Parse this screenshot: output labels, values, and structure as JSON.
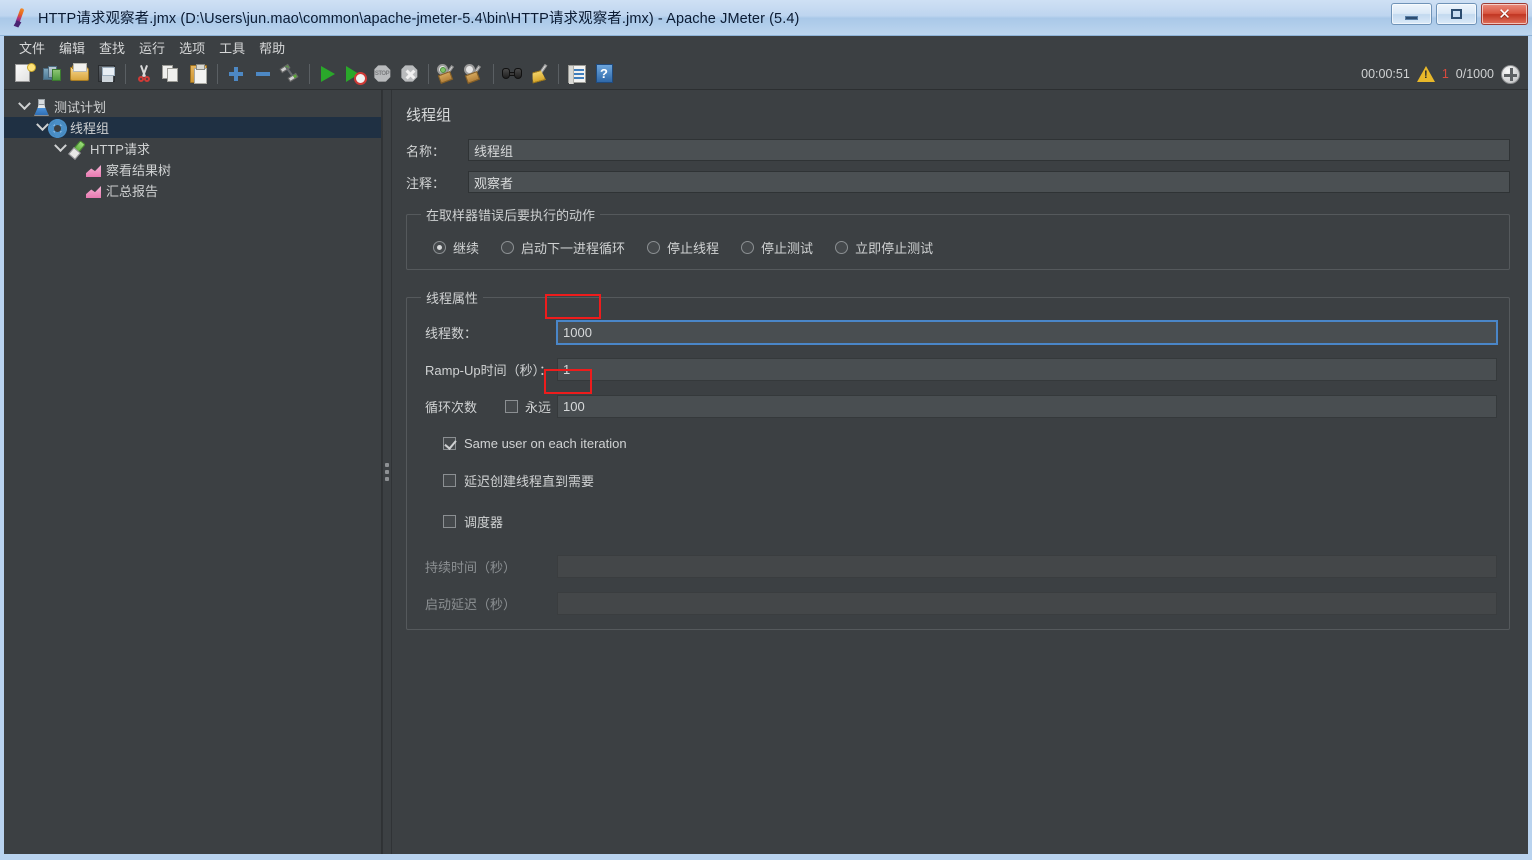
{
  "window": {
    "title": "HTTP请求观察者.jmx (D:\\Users\\jun.mao\\common\\apache-jmeter-5.4\\bin\\HTTP请求观察者.jmx) - Apache JMeter (5.4)",
    "app_icon": "jmeter-feather-icon",
    "buttons": {
      "minimize": "minimize-icon",
      "maximize": "maximize-icon",
      "close": "✕"
    }
  },
  "menubar": {
    "items": [
      {
        "label": "文件",
        "name": "menu-file"
      },
      {
        "label": "编辑",
        "name": "menu-edit"
      },
      {
        "label": "查找",
        "name": "menu-search"
      },
      {
        "label": "运行",
        "name": "menu-run"
      },
      {
        "label": "选项",
        "name": "menu-options"
      },
      {
        "label": "工具",
        "name": "menu-tools"
      },
      {
        "label": "帮助",
        "name": "menu-help"
      }
    ]
  },
  "toolbar": {
    "items": [
      {
        "icon": "new-document-icon"
      },
      {
        "icon": "templates-icon"
      },
      {
        "icon": "open-folder-icon"
      },
      {
        "icon": "save-icon"
      },
      {
        "icon": "cut-icon"
      },
      {
        "icon": "copy-icon"
      },
      {
        "icon": "paste-icon"
      },
      {
        "icon": "expand-all-icon"
      },
      {
        "icon": "collapse-all-icon"
      },
      {
        "icon": "toggle-icon"
      },
      {
        "icon": "start-icon"
      },
      {
        "icon": "start-no-timers-icon"
      },
      {
        "icon": "stop-icon"
      },
      {
        "icon": "shutdown-icon"
      },
      {
        "icon": "clear-icon"
      },
      {
        "icon": "clear-all-icon"
      },
      {
        "icon": "search-icon"
      },
      {
        "icon": "reset-search-icon"
      },
      {
        "icon": "function-helper-icon"
      },
      {
        "icon": "help-icon"
      }
    ],
    "status": {
      "elapsed_time": "00:00:51",
      "warning_icon": "warning-triangle-icon",
      "error_count": "1",
      "active_threads": "0/1000",
      "expand_icon": "expand-arrows-icon"
    }
  },
  "tree": {
    "nodes": [
      {
        "label": "测试计划",
        "icon": "test-plan-icon",
        "depth": 0,
        "expanded": true,
        "selected": false,
        "name": "tree-node-test-plan"
      },
      {
        "label": "线程组",
        "icon": "thread-group-icon",
        "depth": 1,
        "expanded": true,
        "selected": true,
        "name": "tree-node-thread-group"
      },
      {
        "label": "HTTP请求",
        "icon": "http-request-icon",
        "depth": 2,
        "expanded": true,
        "selected": false,
        "name": "tree-node-http-request"
      },
      {
        "label": "察看结果树",
        "icon": "view-results-tree-icon",
        "depth": 3,
        "expanded": false,
        "selected": false,
        "name": "tree-node-view-results-tree"
      },
      {
        "label": "汇总报告",
        "icon": "summary-report-icon",
        "depth": 3,
        "expanded": false,
        "selected": false,
        "name": "tree-node-summary-report"
      }
    ]
  },
  "editor": {
    "panel_title": "线程组",
    "name_field": {
      "label": "名称：",
      "value": "线程组"
    },
    "comment_field": {
      "label": "注释：",
      "value": "观察者"
    },
    "error_action": {
      "legend": "在取样器错误后要执行的动作",
      "options": [
        {
          "label": "继续",
          "selected": true,
          "name": "radio-continue"
        },
        {
          "label": "启动下一进程循环",
          "selected": false,
          "name": "radio-start-next-loop"
        },
        {
          "label": "停止线程",
          "selected": false,
          "name": "radio-stop-thread"
        },
        {
          "label": "停止测试",
          "selected": false,
          "name": "radio-stop-test"
        },
        {
          "label": "立即停止测试",
          "selected": false,
          "name": "radio-stop-test-now"
        }
      ]
    },
    "thread_properties": {
      "legend": "线程属性",
      "num_threads": {
        "label": "线程数：",
        "value": "1000",
        "focused": true,
        "annotated": true
      },
      "ramp_up": {
        "label": "Ramp-Up时间（秒）：",
        "value": "1",
        "focused": false,
        "annotated": false
      },
      "loop_count": {
        "label": "循环次数",
        "forever_label": "永远",
        "forever_checked": false,
        "value": "100",
        "annotated": true
      },
      "same_user": {
        "label": "Same user on each iteration",
        "checked": true
      },
      "delay_thread_creation": {
        "label": "延迟创建线程直到需要",
        "checked": false
      },
      "scheduler": {
        "label": "调度器",
        "checked": false
      },
      "duration": {
        "label": "持续时间（秒）",
        "value": "",
        "disabled": true
      },
      "startup_delay": {
        "label": "启动延迟（秒）",
        "value": "",
        "disabled": true
      }
    }
  },
  "colors": {
    "window_chrome": "#b9d3ef",
    "app_background": "#3c4043",
    "tree_selection": "#1f3043",
    "text_primary": "#d0d2d3",
    "focus_border": "#4a86c8",
    "annotation_red": "#ee1c1c",
    "error_red": "#d94a3e"
  }
}
